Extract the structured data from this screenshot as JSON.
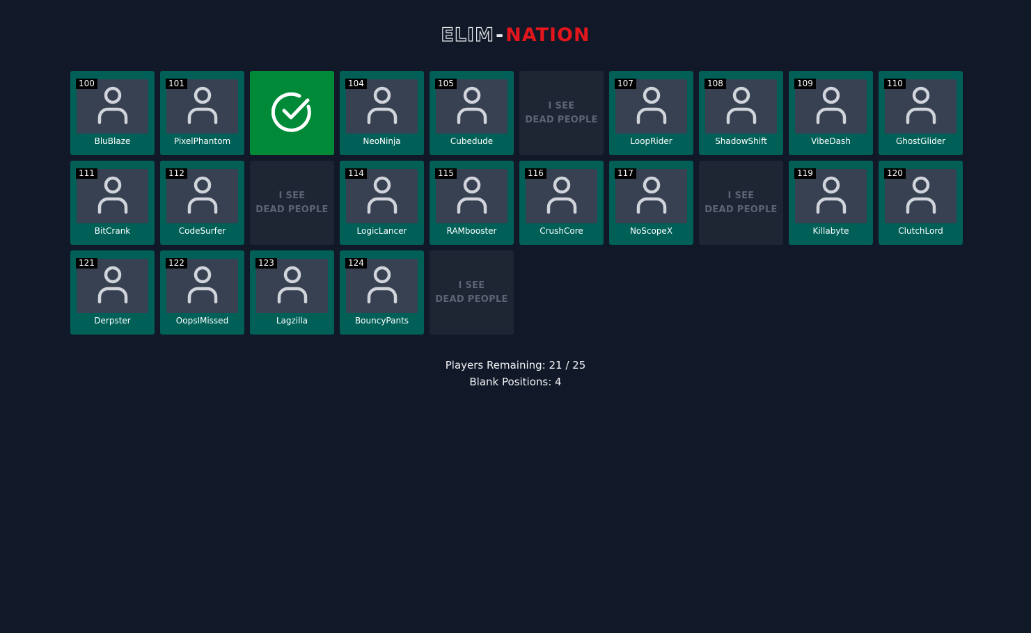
{
  "logo": {
    "part_a": "ELIM",
    "dash": "-",
    "part_b": "NATION"
  },
  "blank_label": {
    "line1": "I SEE",
    "line2": "DEAD PEOPLE"
  },
  "tiles": [
    {
      "type": "player",
      "number": "100",
      "name": "BluBlaze"
    },
    {
      "type": "player",
      "number": "101",
      "name": "PixelPhantom"
    },
    {
      "type": "checked"
    },
    {
      "type": "player",
      "number": "104",
      "name": "NeoNinja"
    },
    {
      "type": "player",
      "number": "105",
      "name": "Cubedude"
    },
    {
      "type": "blank"
    },
    {
      "type": "player",
      "number": "107",
      "name": "LoopRider"
    },
    {
      "type": "player",
      "number": "108",
      "name": "ShadowShift"
    },
    {
      "type": "player",
      "number": "109",
      "name": "VibeDash"
    },
    {
      "type": "player",
      "number": "110",
      "name": "GhostGlider"
    },
    {
      "type": "player",
      "number": "111",
      "name": "BitCrank"
    },
    {
      "type": "player",
      "number": "112",
      "name": "CodeSurfer"
    },
    {
      "type": "blank"
    },
    {
      "type": "player",
      "number": "114",
      "name": "LogicLancer"
    },
    {
      "type": "player",
      "number": "115",
      "name": "RAMbooster"
    },
    {
      "type": "player",
      "number": "116",
      "name": "CrushCore"
    },
    {
      "type": "player",
      "number": "117",
      "name": "NoScopeX"
    },
    {
      "type": "blank"
    },
    {
      "type": "player",
      "number": "119",
      "name": "Killabyte"
    },
    {
      "type": "player",
      "number": "120",
      "name": "ClutchLord"
    },
    {
      "type": "player",
      "number": "121",
      "name": "Derpster"
    },
    {
      "type": "player",
      "number": "122",
      "name": "OopsIMissed"
    },
    {
      "type": "player",
      "number": "123",
      "name": "Lagzilla"
    },
    {
      "type": "player",
      "number": "124",
      "name": "BouncyPants"
    },
    {
      "type": "blank"
    }
  ],
  "stats": {
    "remaining": "Players Remaining: 21 / 25",
    "blank": "Blank Positions: 4"
  },
  "colors": {
    "background": "#111827",
    "player_tile": "#006058",
    "checked_tile": "#008a38",
    "blank_tile": "#1e2533",
    "logo_accent": "#e2161c"
  },
  "icons": {
    "player": "user-icon",
    "checked": "check-circle-icon"
  }
}
